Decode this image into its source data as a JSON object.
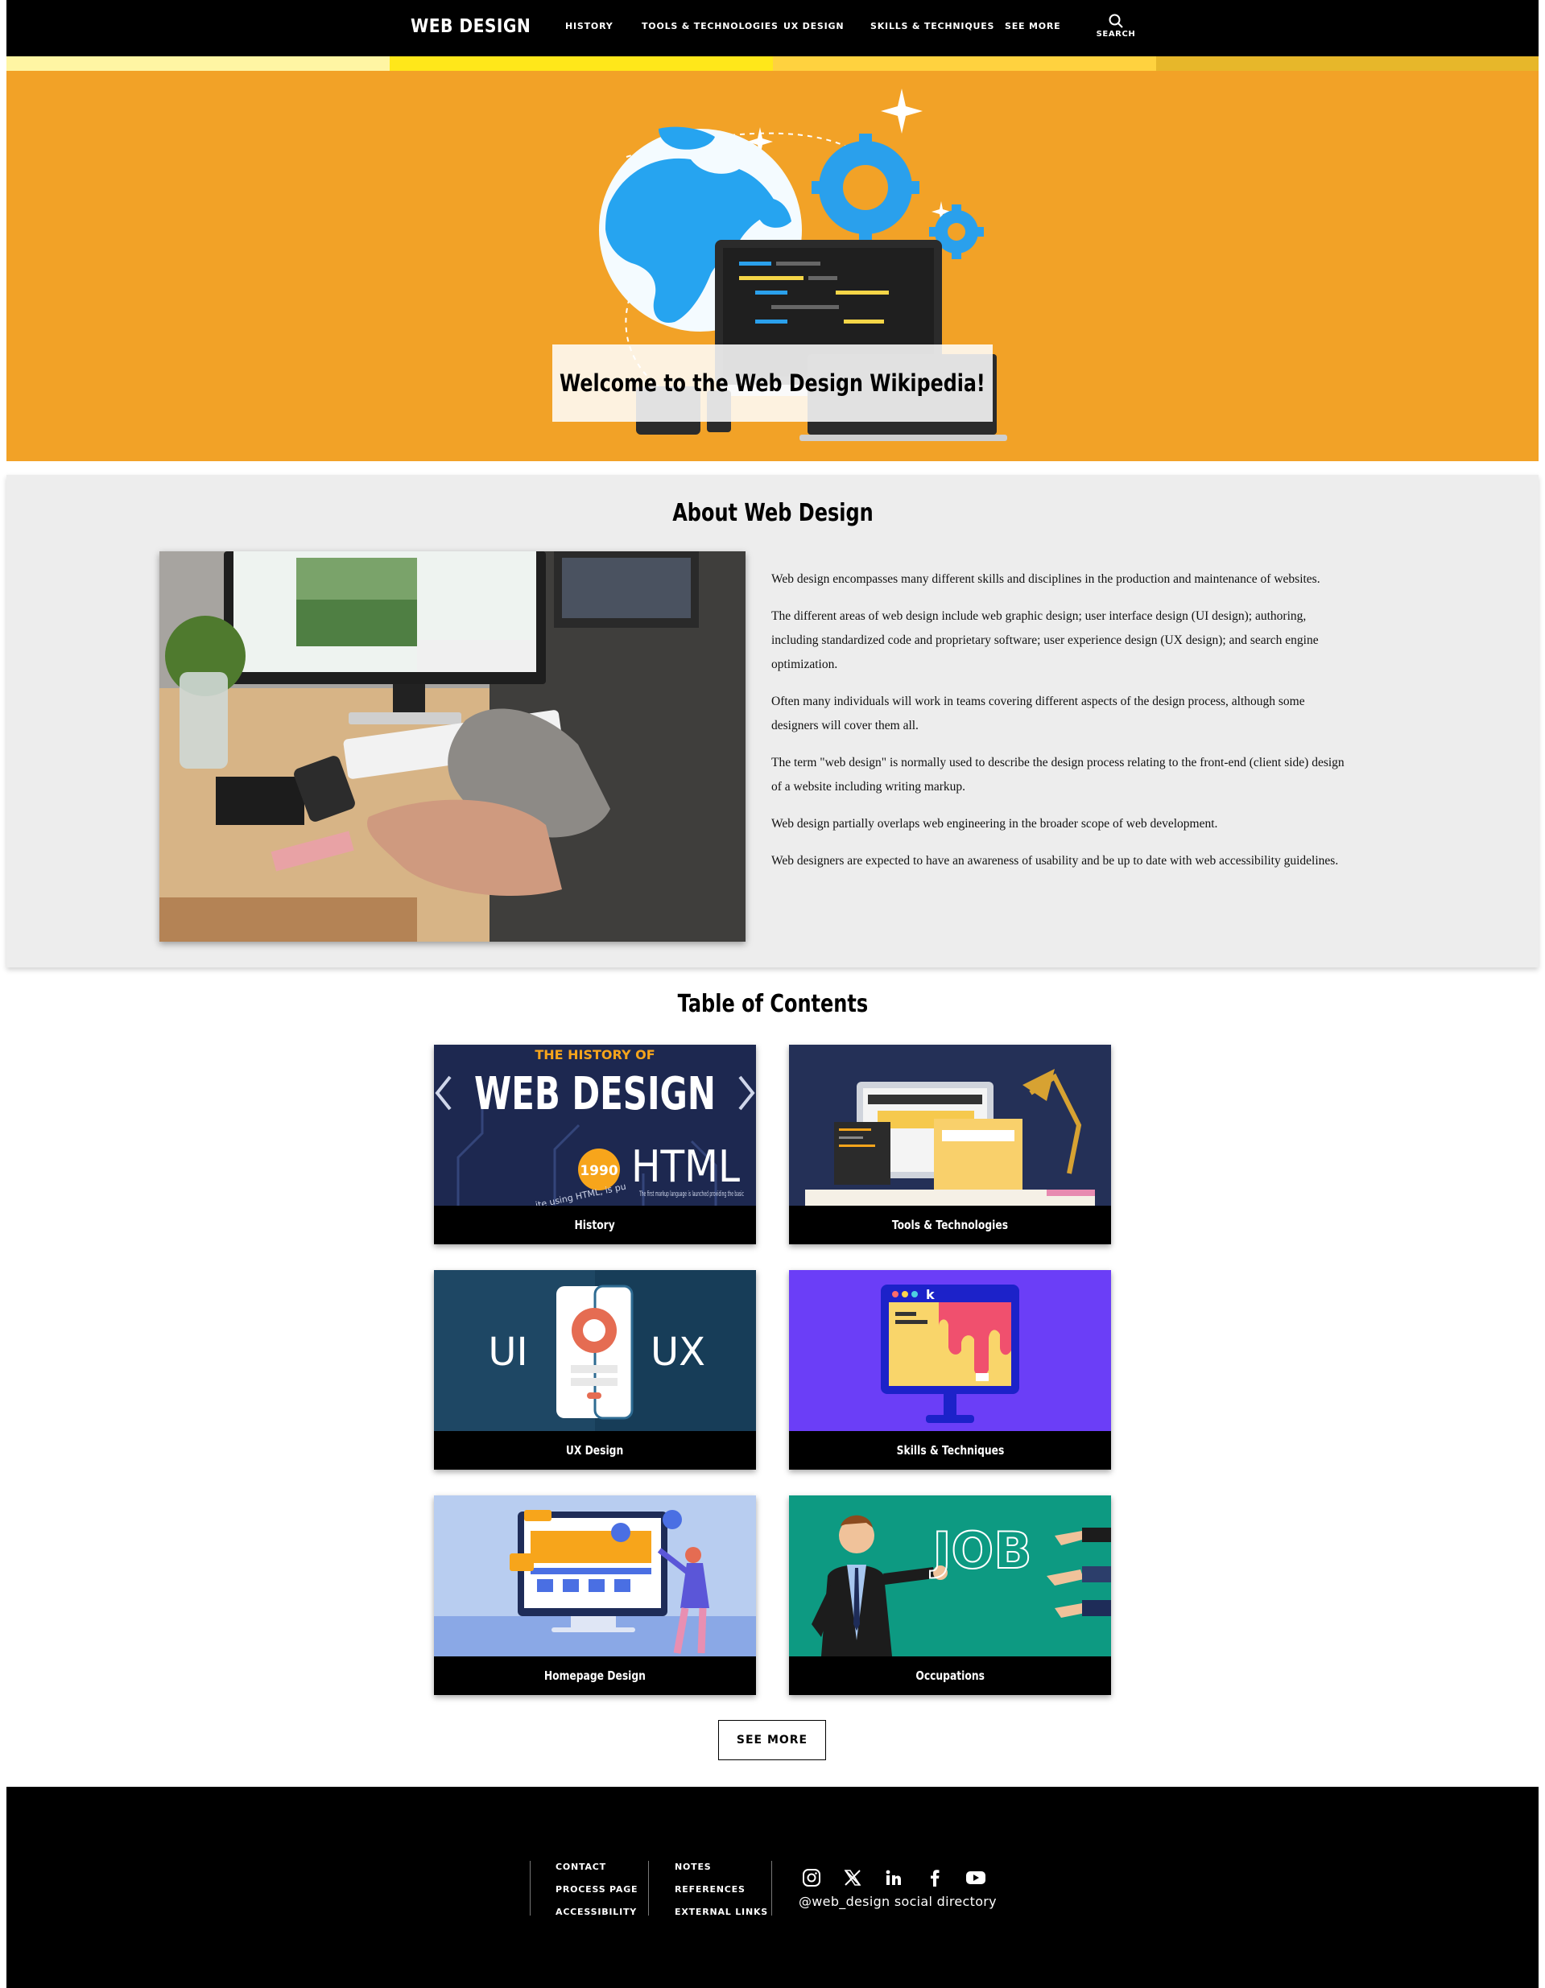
{
  "nav": {
    "brand": "WEB DESIGN",
    "links": [
      "HISTORY",
      "TOOLS & TECHNOLOGIES",
      "UX DESIGN",
      "SKILLS & TECHNIQUES",
      "SEE MORE"
    ],
    "search_label": "SEARCH"
  },
  "colors": {
    "nav_bg": "#000000",
    "stripes": [
      "#fff5a3",
      "#ffe71a",
      "#ffd23f",
      "#e7b72a"
    ],
    "hero_bg": "#f2a227",
    "about_bg": "#ededed"
  },
  "hero": {
    "title": "Welcome to the Web Design Wikipedia!"
  },
  "about": {
    "title": "About Web Design",
    "paragraphs": [
      "Web design encompasses many different skills and disciplines in the production and maintenance of websites.",
      "The different areas of web design include web graphic design; user interface design (UI design); authoring, including standardized code and proprietary software; user experience design (UX design); and search engine optimization.",
      "Often many individuals will work in teams covering different aspects of the design process, although some designers will cover them all.",
      "The term \"web design\" is normally used to describe the design process relating to the front-end (client side) design of a website including writing markup.",
      "Web design partially overlaps web engineering in the broader scope of web development.",
      "Web designers are expected to have an awareness of usability and be up to date with web accessibility guidelines."
    ]
  },
  "toc": {
    "title": "Table of Contents",
    "cards": [
      {
        "label": "History",
        "img_text": {
          "line1": "THE HISTORY OF",
          "line2": "WEB DESIGN",
          "year": "1990",
          "tag": "HTML",
          "caption": "The first markup language is launched providing the basic",
          "curved": "ite using HTML, is pu"
        }
      },
      {
        "label": "Tools & Technologies"
      },
      {
        "label": "UX Design",
        "img_text": {
          "left": "UI",
          "right": "UX"
        }
      },
      {
        "label": "Skills & Techniques",
        "img_text": {
          "logo": "k"
        }
      },
      {
        "label": "Homepage Design"
      },
      {
        "label": "Occupations",
        "img_text": {
          "word": "JOB"
        }
      }
    ],
    "see_more": "SEE MORE"
  },
  "footer": {
    "col1": [
      "CONTACT",
      "PROCESS PAGE",
      "ACCESSIBILITY"
    ],
    "col2": [
      "NOTES",
      "REFERENCES",
      "EXTERNAL LINKS"
    ],
    "social_icons": [
      "instagram-icon",
      "x-icon",
      "linkedin-icon",
      "facebook-icon",
      "youtube-icon"
    ],
    "social_handle": "@web_design social directory"
  }
}
